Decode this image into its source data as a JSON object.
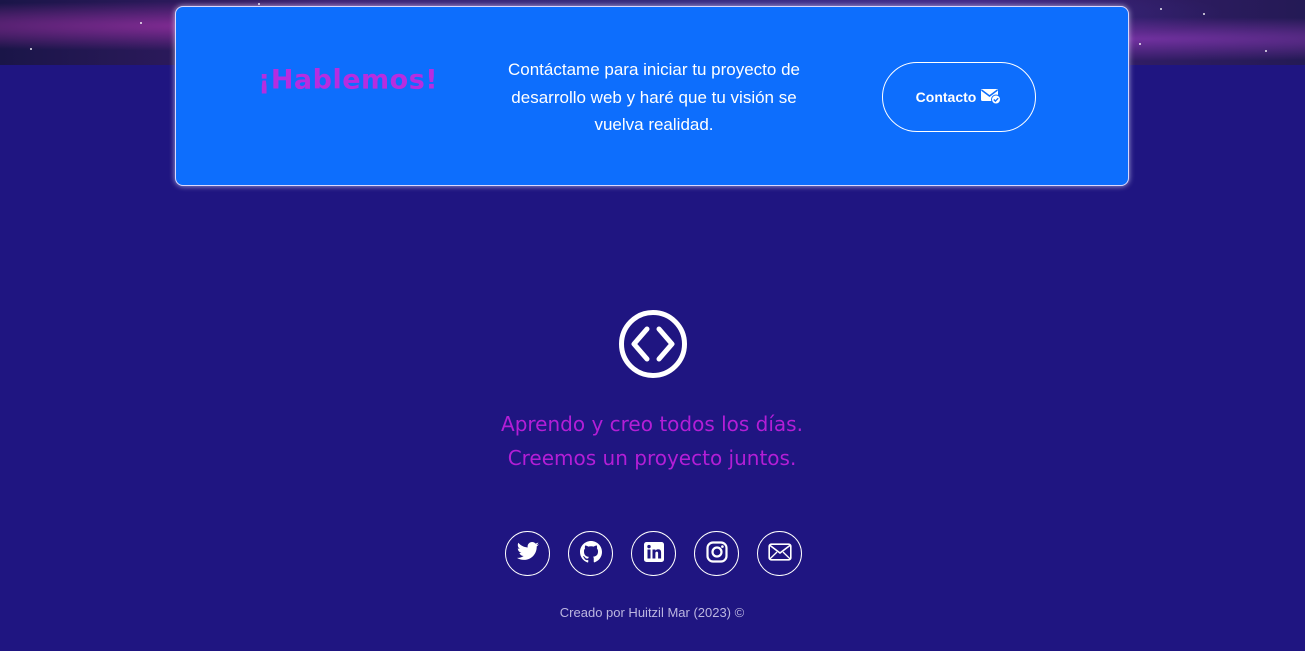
{
  "hero": {
    "background": "galaxy"
  },
  "cta": {
    "heading": "¡Hablemos!",
    "text": "Contáctame para iniciar tu proyecto de desarrollo web y haré que tu visión se vuelva realidad.",
    "button_label": "Contacto",
    "button_icon": "mail-check-icon",
    "card_color": "#0d6efd",
    "heading_color": "#b62de0"
  },
  "footer": {
    "logo_icon": "code-circle-icon",
    "tagline_1": "Aprendo y creo todos los días.",
    "tagline_2": "Creemos un proyecto juntos.",
    "tagline_color": "#b31ed6",
    "social": [
      {
        "icon": "twitter-icon"
      },
      {
        "icon": "github-icon"
      },
      {
        "icon": "linkedin-icon"
      },
      {
        "icon": "instagram-icon"
      },
      {
        "icon": "envelope-icon"
      }
    ],
    "credit": "Creado por Huitzil Mar (2023) ©"
  },
  "colors": {
    "background": "#1f1581"
  }
}
